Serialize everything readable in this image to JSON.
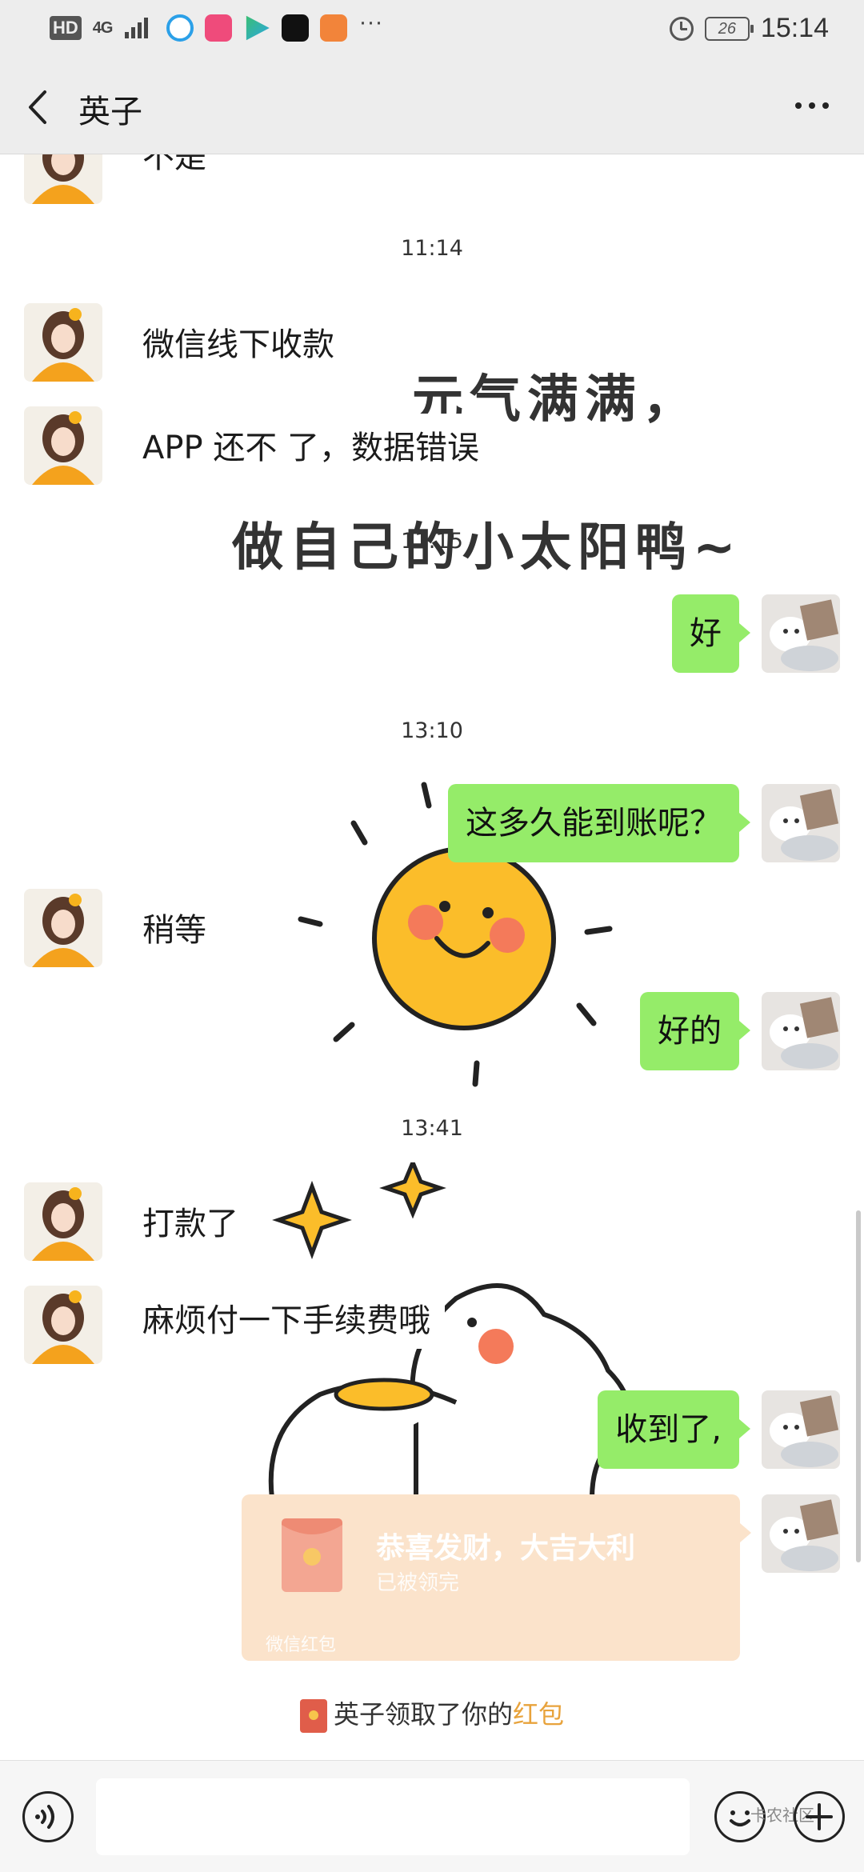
{
  "status_bar": {
    "hd_label": "HD",
    "network_label": "4G",
    "time": "15:14",
    "battery": "26",
    "overflow_glyph": "···"
  },
  "nav": {
    "title": "英子",
    "back_icon": "chevron-left-icon",
    "more_icon": "more-dots-icon"
  },
  "chat": {
    "partial_top_message": "不是",
    "sticker_lines": [
      "元气满满，",
      "做自己的小太阳鸭~"
    ],
    "items": [
      {
        "type": "time",
        "text": "11:14"
      },
      {
        "type": "in",
        "text": "微信线下收款"
      },
      {
        "type": "in",
        "text": "APP 还不 了，数据错误"
      },
      {
        "type": "time",
        "text": "11:15"
      },
      {
        "type": "out",
        "text": "好"
      },
      {
        "type": "time",
        "text": "13:10"
      },
      {
        "type": "out",
        "text": "这多久能到账呢？"
      },
      {
        "type": "in",
        "text": "稍等"
      },
      {
        "type": "out",
        "text": "好的"
      },
      {
        "type": "time",
        "text": "13:41"
      },
      {
        "type": "in",
        "text": "打款了"
      },
      {
        "type": "in",
        "text": "麻烦付一下手续费哦"
      },
      {
        "type": "out",
        "text": "收到了,"
      }
    ],
    "red_packet": {
      "title": "恭喜发财，大吉大利",
      "status": "已被领完",
      "footer": "微信红包"
    },
    "system_notice": {
      "prefix": "英子领取了你的",
      "highlight": "红包"
    }
  },
  "input_bar": {
    "value": "",
    "voice_icon": "voice-icon",
    "emoji_icon": "emoji-icon",
    "plus_icon": "plus-icon",
    "watermark": "卡农社区"
  },
  "colors": {
    "bubble_out": "#95ec69",
    "nav_bg": "#ededed",
    "red_packet_bg": "#fbe3cb",
    "highlight": "#e8a33c"
  }
}
